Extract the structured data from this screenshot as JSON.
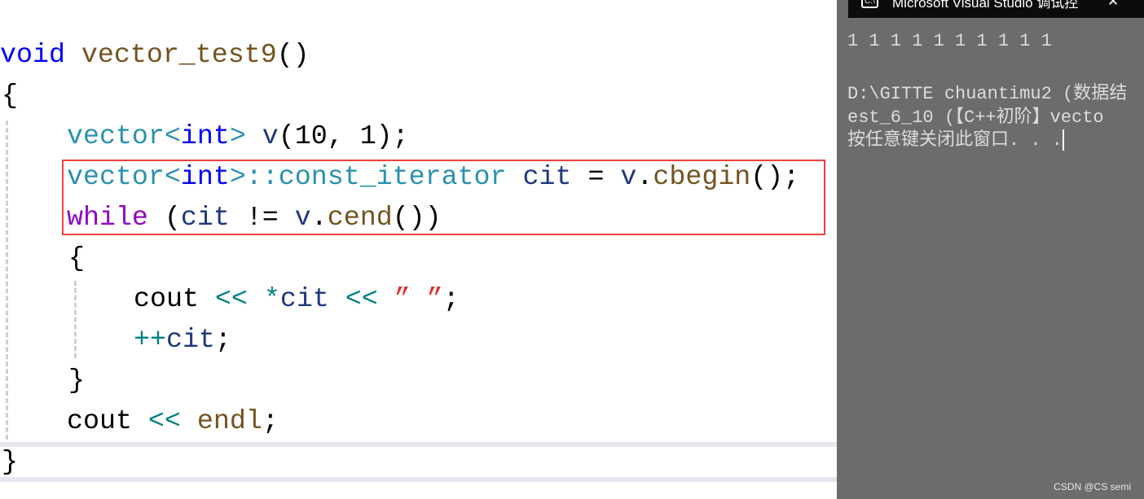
{
  "code": {
    "l1": [
      "void",
      " ",
      "vector_test9",
      "()"
    ],
    "l2": "{",
    "l3": [
      "vector",
      "<",
      "int",
      "> ",
      "v",
      "(10, 1);"
    ],
    "l4": [
      "vector",
      "<",
      "int",
      ">::",
      "const_iterator",
      " ",
      "cit",
      " = ",
      "v",
      ".",
      "cbegin",
      "();"
    ],
    "l5": [
      "while",
      " (",
      "cit",
      " != ",
      "v",
      ".",
      "cend",
      "())"
    ],
    "l6": "{",
    "l7": [
      "cout",
      " ",
      "<<",
      " ",
      "*",
      "cit",
      " ",
      "<<",
      " ",
      "” ”",
      ";"
    ],
    "l8": [
      "++",
      "cit",
      ";"
    ],
    "l9": "}",
    "l10": [
      "cout",
      " ",
      "<<",
      " ",
      "endl",
      ";"
    ],
    "l11": "}"
  },
  "console": {
    "title": "Microsoft Visual Studio 调试控",
    "title_icon": "console-icon",
    "output": "1 1 1 1 1 1 1 1 1 1",
    "path_line1": "D:\\GITTE chuantimu2 (数据结",
    "path_line2": "est_6_10 (【C++初阶】vecto",
    "prompt": "按任意键关闭此窗口. . ."
  },
  "watermark": "CSDN @CS semi",
  "colors": {
    "highlight_box": "#f04040",
    "keyword": "#0000ff",
    "function": "#74531f",
    "type": "#2b91af",
    "control": "#8f08c4"
  }
}
